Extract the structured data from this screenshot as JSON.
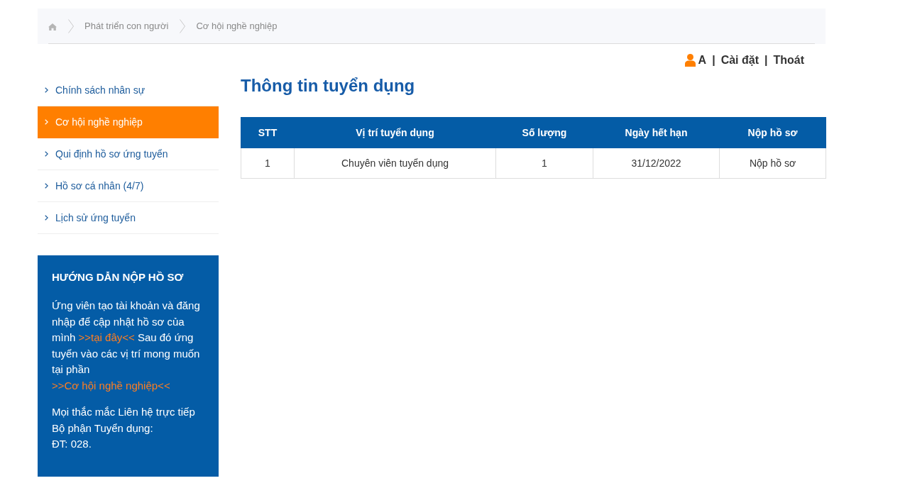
{
  "breadcrumb": {
    "items": [
      {
        "label": "Phát triển con người"
      },
      {
        "label": "Cơ hội nghề nghiệp"
      }
    ]
  },
  "user_menu": {
    "items": [
      {
        "kind": "user",
        "label": "A"
      },
      {
        "kind": "separator",
        "label": "|"
      },
      {
        "kind": "link",
        "label": "Cài đặt"
      },
      {
        "kind": "separator",
        "label": "|"
      },
      {
        "kind": "link",
        "label": "Thoát"
      }
    ]
  },
  "sidebar": {
    "items": [
      {
        "label": "Chính sách nhân sự",
        "selected": false
      },
      {
        "label": "Cơ hội nghề nghiệp",
        "selected": true
      },
      {
        "label": "Qui định hồ sơ ứng tuyển",
        "selected": false
      },
      {
        "label": "Hồ sơ cá nhân (4/7)",
        "selected": false
      },
      {
        "label": "Lịch sử ứng tuyển",
        "selected": false
      }
    ]
  },
  "guide": {
    "title": "HƯỚNG DẪN NỘP HỒ SƠ",
    "intro": [
      {
        "kind": "text",
        "text": "Ứng viên tạo tài khoản và đăng nhập để cập nhật hồ sơ của mình "
      },
      {
        "kind": "link",
        "text": ">>tại đây<<"
      },
      {
        "kind": "text",
        "text": "  Sau đó ứng tuyển vào các vị trí mong muốn tại phần "
      },
      {
        "kind": "link",
        "text": ">>Cơ hội nghề nghiệp<<"
      }
    ],
    "contact": "Mọi thắc mắc Liên hệ trực tiếp Bộ phận Tuyển dụng:",
    "phone": "ĐT: 028."
  },
  "main": {
    "title": "Thông tin tuyển dụng"
  },
  "table": {
    "columns": [
      "STT",
      "Vị trí tuyển dụng",
      "Số lượng",
      "Ngày hết hạn",
      "Nộp hồ sơ"
    ],
    "rows": [
      [
        "1",
        "Chuyên viên tuyển dụng",
        "1",
        "31/12/2022",
        "Nộp hồ sơ"
      ]
    ]
  }
}
